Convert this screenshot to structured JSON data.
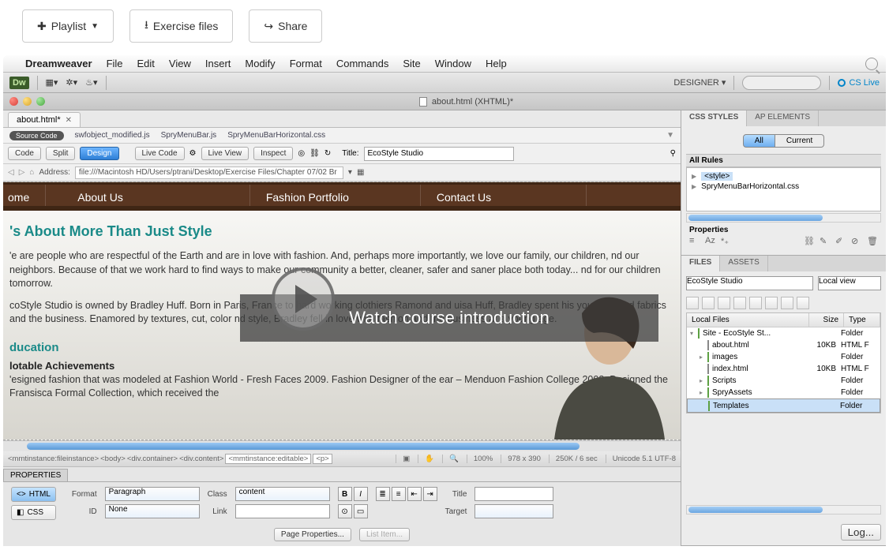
{
  "page_buttons": {
    "playlist": "Playlist",
    "exercise": "Exercise files",
    "share": "Share"
  },
  "menubar": {
    "app": "Dreamweaver",
    "items": [
      "File",
      "Edit",
      "View",
      "Insert",
      "Modify",
      "Format",
      "Commands",
      "Site",
      "Window",
      "Help"
    ]
  },
  "toolbar": {
    "designer": "DESIGNER ▾",
    "cslive": "CS Live"
  },
  "doc_title": "about.html (XHTML)*",
  "file_tab": "about.html*",
  "subfiles": {
    "source": "Source Code",
    "files": [
      "swfobject_modified.js",
      "SpryMenuBar.js",
      "SpryMenuBarHorizontal.css"
    ]
  },
  "view": {
    "code": "Code",
    "split": "Split",
    "design": "Design",
    "live_code": "Live Code",
    "live_view": "Live View",
    "inspect": "Inspect",
    "title_label": "Title:",
    "title_value": "EcoStyle Studio"
  },
  "address": {
    "label": "Address:",
    "value": "file:///Macintosh HD/Users/ptrani/Desktop/Exercise Files/Chapter 07/02 Br"
  },
  "site_nav": [
    "ome",
    "About Us",
    "Fashion Portfolio",
    "Contact Us"
  ],
  "content": {
    "h2": "'s About More Than Just Style",
    "p1": "'e are people who are respectful of the Earth and are in love with fashion. And, perhaps more importantly, we love our family, our children, nd our neighbors. Because of that we work hard to find ways to make our community a better, cleaner, safer and saner place both today... nd for our children tomorrow.",
    "p2": "coStyle Studio is owned by Bradley Huff.  Born in Paris, France to hard working clothiers Ramond and uisa Huff, Bradley spent his youth around fabrics and the business.  Enamored by textures, cut, color nd style, Bradley fell in love with fashion and the business at a young age.",
    "h3": "ducation",
    "h4": "lotable Achievements",
    "p3": "'esigned fashion that was modeled at Fashion World - Fresh Faces 2009.  Fashion Designer of the ear – Menduon Fashion College 2008.  Designed the Fransisca Formal Collection, which received the"
  },
  "overlay_text": "Watch course introduction",
  "tag_selector": {
    "tags": [
      "<mmtinstance:fileinstance>",
      "<body>",
      "<div.container>",
      "<div.content>",
      "<mmtinstance:editable>",
      "<p>"
    ],
    "zoom": "100%",
    "dims": "978 x 390",
    "size": "250K / 6 sec",
    "enc": "Unicode 5.1 UTF-8"
  },
  "props": {
    "tab": "PROPERTIES",
    "html": "HTML",
    "css": "CSS",
    "format_label": "Format",
    "format_value": "Paragraph",
    "id_label": "ID",
    "id_value": "None",
    "class_label": "Class",
    "class_value": "content",
    "link_label": "Link",
    "link_value": "",
    "title_label": "Title",
    "title_value": "",
    "target_label": "Target",
    "target_value": "",
    "btn_b": "B",
    "btn_i": "I",
    "page_props": "Page Properties...",
    "list_item": "List Item..."
  },
  "css_panel": {
    "tab1": "CSS STYLES",
    "tab2": "AP ELEMENTS",
    "seg_all": "All",
    "seg_current": "Current",
    "rules_head": "All Rules",
    "rule1": "<style>",
    "rule2": "SpryMenuBarHorizontal.css",
    "prop_head": "Properties"
  },
  "files_panel": {
    "tab1": "FILES",
    "tab2": "ASSETS",
    "site": "EcoStyle Studio",
    "view": "Local view",
    "hdr1": "Local Files",
    "hdr2": "Size",
    "hdr3": "Type",
    "rows": [
      {
        "name": "Site - EcoStyle St...",
        "size": "",
        "type": "Folder",
        "depth": 0,
        "kind": "folder",
        "exp": "▾"
      },
      {
        "name": "about.html",
        "size": "10KB",
        "type": "HTML F",
        "depth": 1,
        "kind": "file",
        "exp": ""
      },
      {
        "name": "images",
        "size": "",
        "type": "Folder",
        "depth": 1,
        "kind": "folder",
        "exp": "▸"
      },
      {
        "name": "index.html",
        "size": "10KB",
        "type": "HTML F",
        "depth": 1,
        "kind": "file",
        "exp": ""
      },
      {
        "name": "Scripts",
        "size": "",
        "type": "Folder",
        "depth": 1,
        "kind": "folder",
        "exp": "▸"
      },
      {
        "name": "SpryAssets",
        "size": "",
        "type": "Folder",
        "depth": 1,
        "kind": "folder",
        "exp": "▸"
      },
      {
        "name": "Templates",
        "size": "",
        "type": "Folder",
        "depth": 1,
        "kind": "folder",
        "exp": "",
        "sel": true
      }
    ],
    "log": "Log..."
  }
}
